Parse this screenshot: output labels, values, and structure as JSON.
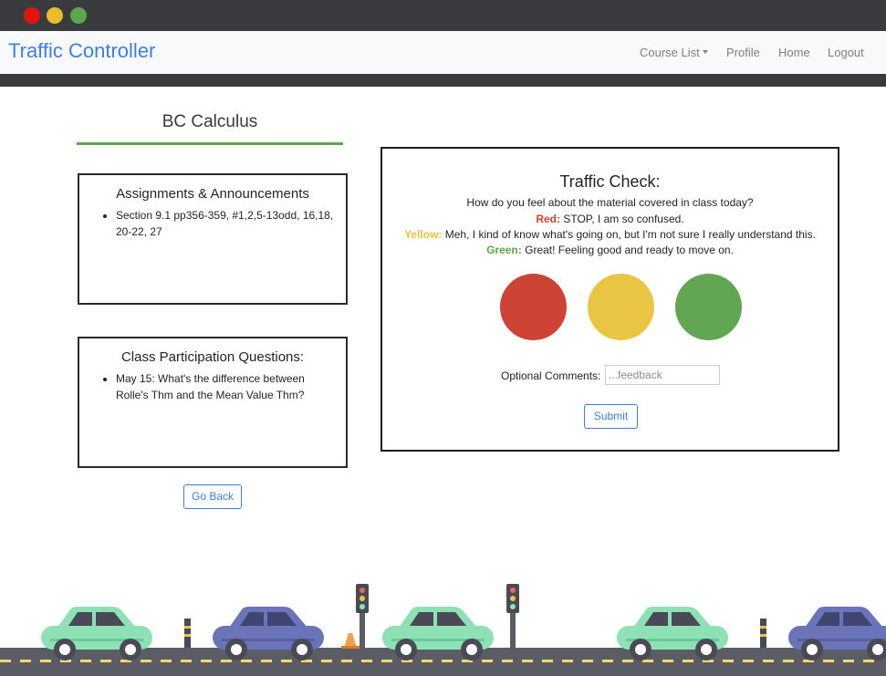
{
  "window": {
    "controls": [
      "close",
      "minimize",
      "maximize"
    ]
  },
  "navbar": {
    "brand": "Traffic Controller",
    "links": {
      "course_list": "Course List",
      "profile": "Profile",
      "home": "Home",
      "logout": "Logout"
    }
  },
  "course": {
    "title": "BC Calculus"
  },
  "assignments": {
    "heading": "Assignments & Announcements",
    "items": [
      "Section 9.1 pp356-359, #1,2,5-13odd, 16,18, 20-22, 27"
    ]
  },
  "participation": {
    "heading": "Class Participation Questions:",
    "items": [
      "May 15: What's the difference between Rolle's Thm and the Mean Value Thm?"
    ]
  },
  "go_back_label": "Go Back",
  "traffic_check": {
    "title": "Traffic Check:",
    "question": "How do you feel about the material covered in class today?",
    "red_label": "Red:",
    "red_text": "STOP, I am so confused.",
    "yellow_label": "Yellow:",
    "yellow_text": "Meh, I kind of know what's going on, but I'm not sure I really understand this.",
    "green_label": "Green:",
    "green_text": "Great! Feeling good and ready to move on.",
    "comments_label": "Optional Comments:",
    "comments_placeholder": "...feedback",
    "comments_value": "",
    "submit_label": "Submit"
  },
  "colors": {
    "brand": "#3f7fe5",
    "accent_green": "#5ea64d",
    "light_red": "#cd4437",
    "light_yellow": "#e9c544",
    "light_green": "#62a553",
    "dark_bar": "#3a3b3f"
  },
  "icons": [
    "traffic-light-icon",
    "car-icon",
    "traffic-cone-icon",
    "bollard-icon"
  ]
}
